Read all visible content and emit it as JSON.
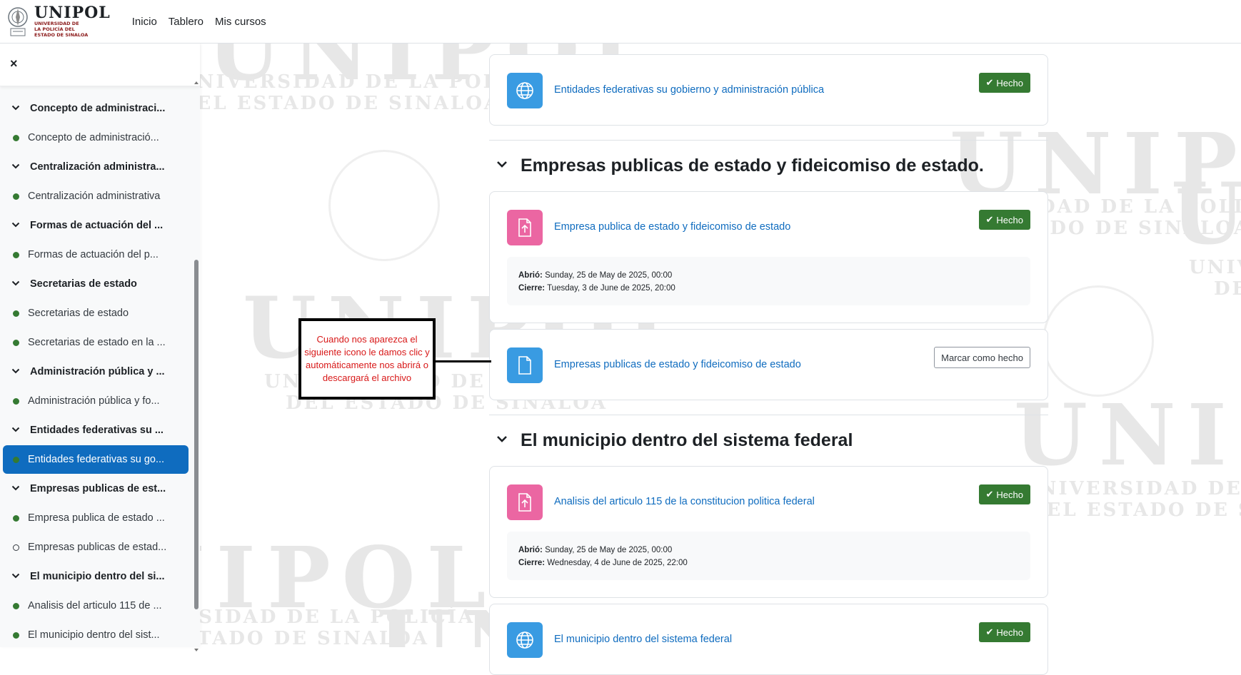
{
  "brand": {
    "name": "UNIPOL",
    "subtitle_lines": [
      "UNIVERSIDAD DE",
      "LA POLICÍA DEL",
      "ESTADO DE SINALOA"
    ]
  },
  "nav": {
    "links": [
      "Inicio",
      "Tablero",
      "Mis cursos"
    ]
  },
  "watermark": {
    "word": "UNIPOL",
    "line1": "UNIVERSIDAD DE LA POLICÍA",
    "line2": "DEL ESTADO DE SINALOA"
  },
  "drawer": {
    "close_icon": "×",
    "items": [
      {
        "type": "section",
        "label": "Concepto de administraci..."
      },
      {
        "type": "activity",
        "label": "Concepto de administració...",
        "status": "done"
      },
      {
        "type": "section",
        "label": "Centralización administra..."
      },
      {
        "type": "activity",
        "label": "Centralización administrativa",
        "status": "done"
      },
      {
        "type": "section",
        "label": "Formas de actuación del ..."
      },
      {
        "type": "activity",
        "label": "Formas de actuación del p...",
        "status": "done"
      },
      {
        "type": "section",
        "label": "Secretarias de estado"
      },
      {
        "type": "activity",
        "label": "Secretarias de estado",
        "status": "done"
      },
      {
        "type": "activity",
        "label": "Secretarias de estado en la ...",
        "status": "done"
      },
      {
        "type": "section",
        "label": "Administración pública y ..."
      },
      {
        "type": "activity",
        "label": "Administración pública y fo...",
        "status": "done"
      },
      {
        "type": "section",
        "label": "Entidades federativas su ..."
      },
      {
        "type": "activity",
        "label": "Entidades federativas su go...",
        "status": "done",
        "current": true
      },
      {
        "type": "section",
        "label": "Empresas publicas de est..."
      },
      {
        "type": "activity",
        "label": "Empresa publica de estado ...",
        "status": "done"
      },
      {
        "type": "activity",
        "label": "Empresas publicas de estad...",
        "status": "open"
      },
      {
        "type": "section",
        "label": "El municipio dentro del si..."
      },
      {
        "type": "activity",
        "label": "Analisis del articulo 115 de ...",
        "status": "done"
      },
      {
        "type": "activity",
        "label": "El municipio dentro del sist...",
        "status": "done"
      }
    ]
  },
  "main": {
    "card_top": {
      "icon": "globe-icon",
      "link": "Entidades federativas su gobierno y administración pública",
      "button": "Hecho"
    },
    "section_empresas": {
      "title": "Empresas publicas de estado y fideicomiso de estado.",
      "assignment": {
        "icon": "assignment-upload-icon",
        "link": "Empresa publica de estado y fideicomiso de estado",
        "button": "Hecho",
        "opened_label": "Abrió:",
        "opened_value": "Sunday, 25 de May de 2025, 00:00",
        "closes_label": "Cierre:",
        "closes_value": "Tuesday, 3 de June de 2025, 20:00"
      },
      "resource": {
        "icon": "file-icon",
        "link": "Empresas publicas de estado y fideicomiso de estado",
        "button": "Marcar como hecho"
      }
    },
    "section_municipio": {
      "title": "El municipio dentro del sistema federal",
      "assignment": {
        "icon": "assignment-upload-icon",
        "link": "Analisis del articulo 115 de la constitucion politica federal",
        "button": "Hecho",
        "opened_label": "Abrió:",
        "opened_value": "Sunday, 25 de May de 2025, 00:00",
        "closes_label": "Cierre:",
        "closes_value": "Wednesday, 4 de June de 2025, 22:00"
      },
      "url": {
        "icon": "globe-icon",
        "link": "El municipio dentro del sistema federal",
        "button": "Hecho"
      }
    }
  },
  "annotation": {
    "text": "Cuando nos aparezca el siguiente icono le damos clic y automáticamente  nos abrirá o descargará el archivo"
  },
  "colors": {
    "primary": "#0f6cbf",
    "success": "#357a32",
    "icon_blue": "#399be2",
    "icon_pink": "#eb66a2",
    "annotation_text": "#d81818"
  }
}
